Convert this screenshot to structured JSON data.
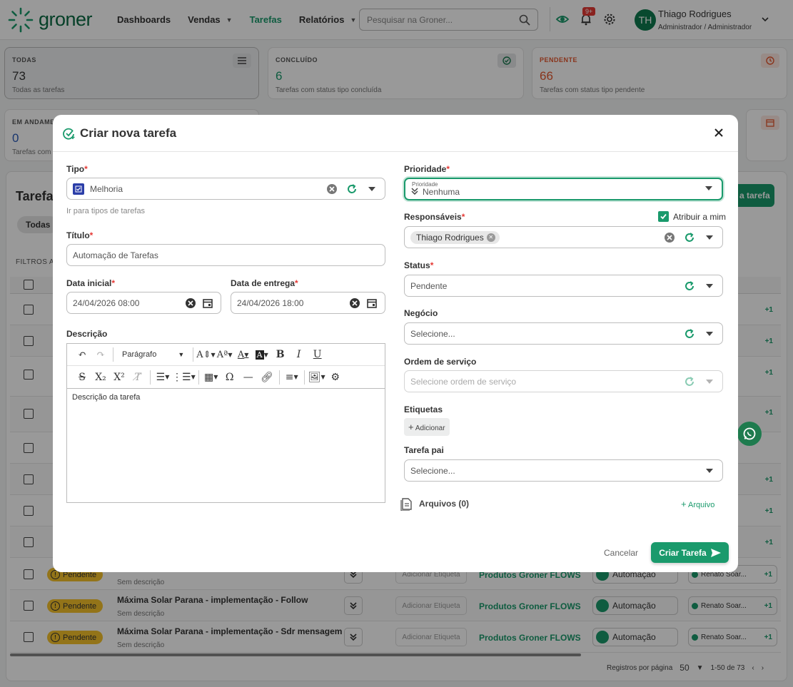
{
  "app": {
    "logo_text": "groner",
    "brand_color": "#1a9a6c"
  },
  "nav": {
    "items": [
      {
        "label": "Dashboards",
        "active": false,
        "has_caret": false
      },
      {
        "label": "Vendas",
        "active": false,
        "has_caret": true
      },
      {
        "label": "Tarefas",
        "active": true,
        "has_caret": false
      },
      {
        "label": "Relatórios",
        "active": false,
        "has_caret": true
      }
    ],
    "search_placeholder": "Pesquisar na Groner...",
    "notification_badge": "9+",
    "user": {
      "initials": "TH",
      "name": "Thiago Rodrigues",
      "role": "Administrador / Administrador"
    }
  },
  "stats": [
    {
      "label": "TODAS",
      "value": "73",
      "sub": "Todas as tarefas",
      "icon": "list-icon"
    },
    {
      "label": "CONCLUÍDO",
      "value": "6",
      "sub": "Tarefas com status tipo concluída",
      "icon": "check-circle-icon"
    },
    {
      "label": "PENDENTE",
      "value": "66",
      "sub": "Tarefas com status tipo pendente",
      "icon": "clock-icon",
      "color": "#e4572e"
    },
    {
      "label": "EM ANDAMENTO",
      "value": "0",
      "sub": "Tarefas com"
    }
  ],
  "background": {
    "heading": "Tarefas",
    "chip_all": "Todas",
    "filters_label": "FILTROS AT",
    "new_task_label": "a tarefa",
    "rows": [
      {
        "status": "Pendente",
        "title": "",
        "sub": "Sem descrição",
        "etiqueta": "Adicionar Etiqueta",
        "produto": "Produtos Groner FLOWS",
        "tipo": "Automação",
        "responsavel": "Renato Soar...",
        "plus": "+1"
      },
      {
        "status": "Pendente",
        "title": "Máxima Solar Parana - implementação - Follow",
        "sub": "Sem descrição",
        "etiqueta": "Adicionar Etiqueta",
        "produto": "Produtos Groner FLOWS",
        "tipo": "Automação",
        "responsavel": "Renato Soar...",
        "plus": "+1"
      },
      {
        "status": "Pendente",
        "title": "Máxima Solar Parana - implementação - Sdr mensagem",
        "sub": "Sem descrição",
        "etiqueta": "Adicionar Etiqueta",
        "produto": "Produtos Groner FLOWS",
        "tipo": "Automação",
        "responsavel": "Renato Soar...",
        "plus": "+1"
      }
    ],
    "side_plus": "+1",
    "pagination": {
      "label": "Registros por página",
      "per_page": "50",
      "range": "1-50 de 73"
    }
  },
  "modal": {
    "title": "Criar nova tarefa",
    "tipo": {
      "label": "Tipo",
      "value": "Melhoria",
      "hint": "Ir para tipos de tarefas"
    },
    "titulo": {
      "label": "Título",
      "value": "Automação de Tarefas"
    },
    "data_inicial": {
      "label": "Data inicial",
      "value": "24/04/2026 08:00"
    },
    "data_entrega": {
      "label": "Data de entrega",
      "value": "24/04/2026 18:00"
    },
    "descricao": {
      "label": "Descrição",
      "paragraph_style": "Parágrafo",
      "value": "Descrição da tarefa"
    },
    "prioridade": {
      "label": "Prioridade",
      "float_label": "Prioridade",
      "value": "Nenhuma"
    },
    "responsaveis": {
      "label": "Responsáveis",
      "assign_me": "Atribuir a mim",
      "assign_me_checked": true,
      "chip": "Thiago Rodrigues"
    },
    "status": {
      "label": "Status",
      "value": "Pendente"
    },
    "negocio": {
      "label": "Negócio",
      "placeholder": "Selecione..."
    },
    "ordem_servico": {
      "label": "Ordem de serviço",
      "placeholder": "Selecione ordem de serviço"
    },
    "etiquetas": {
      "label": "Etiquetas",
      "add": "Adicionar"
    },
    "tarefa_pai": {
      "label": "Tarefa pai",
      "placeholder": "Selecione..."
    },
    "arquivos": {
      "label": "Arquivos (0)",
      "add": "Arquivo"
    },
    "cancel": "Cancelar",
    "submit": "Criar Tarefa"
  }
}
